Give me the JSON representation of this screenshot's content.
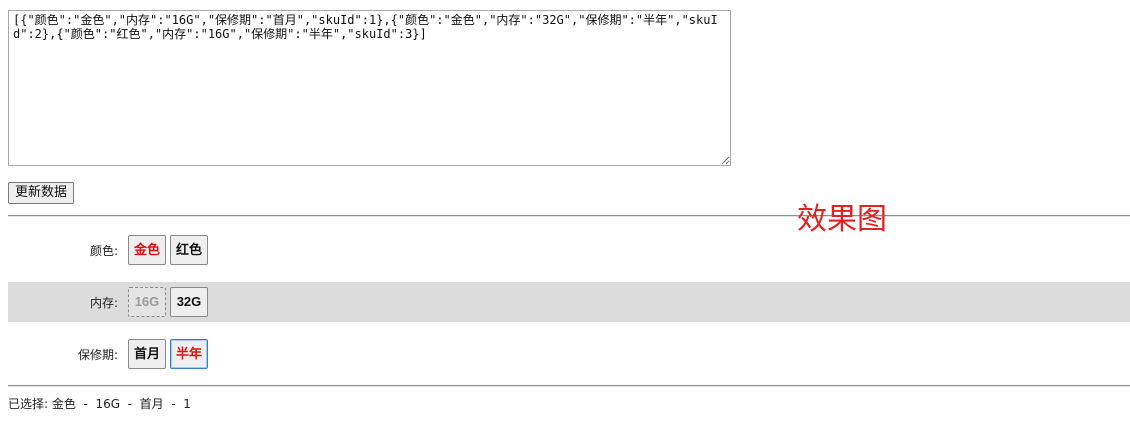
{
  "textarea": {
    "value": "[{\"颜色\":\"金色\",\"内存\":\"16G\",\"保修期\":\"首月\",\"skuId\":1},{\"颜色\":\"金色\",\"内存\":\"32G\",\"保修期\":\"半年\",\"skuId\":2},{\"颜色\":\"红色\",\"内存\":\"16G\",\"保修期\":\"半年\",\"skuId\":3}]"
  },
  "update_button": {
    "label": "更新数据"
  },
  "effect_label": "效果图",
  "specs": {
    "color": {
      "label": "颜色:",
      "options": [
        {
          "label": "金色",
          "state": "selected"
        },
        {
          "label": "红色",
          "state": "normal"
        }
      ]
    },
    "memory": {
      "label": "内存:",
      "options": [
        {
          "label": "16G",
          "state": "disabled"
        },
        {
          "label": "32G",
          "state": "normal"
        }
      ]
    },
    "warranty": {
      "label": "保修期:",
      "options": [
        {
          "label": "首月",
          "state": "normal"
        },
        {
          "label": "半年",
          "state": "selected-focused"
        }
      ]
    }
  },
  "summary": {
    "prefix": "已选择:",
    "text": "金色  -  16G  -  首月  -  1"
  },
  "colors": {
    "selected_text": "#e01010",
    "effect_label": "#e52020",
    "alt_row_bg": "#dcdcdc"
  }
}
